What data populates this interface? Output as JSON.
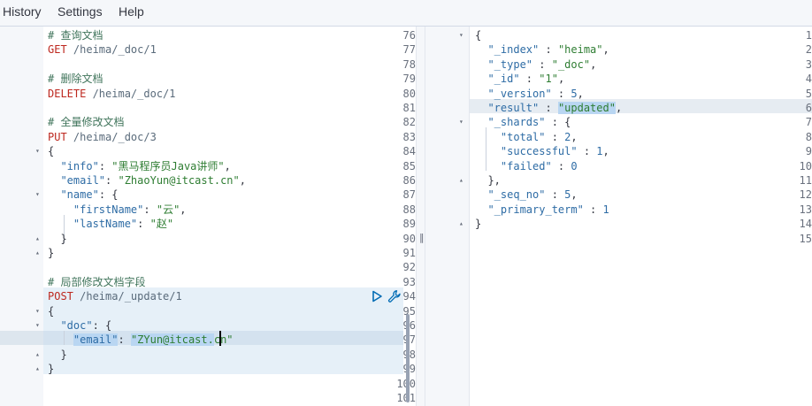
{
  "menu": {
    "history": "History",
    "settings": "Settings",
    "help": "Help"
  },
  "request": {
    "lines": [
      {
        "n": "76",
        "tokens": [
          [
            "comment",
            "# 查询文档"
          ]
        ]
      },
      {
        "n": "77",
        "tokens": [
          [
            "method",
            "GET"
          ],
          [
            "url",
            " /heima/_doc/1"
          ]
        ]
      },
      {
        "n": "78",
        "tokens": []
      },
      {
        "n": "79",
        "tokens": [
          [
            "comment",
            "# 删除文档"
          ]
        ]
      },
      {
        "n": "80",
        "tokens": [
          [
            "method",
            "DELETE"
          ],
          [
            "url",
            " /heima/_doc/1"
          ]
        ]
      },
      {
        "n": "81",
        "tokens": []
      },
      {
        "n": "82",
        "tokens": [
          [
            "comment",
            "# 全量修改文档"
          ]
        ]
      },
      {
        "n": "83",
        "tokens": [
          [
            "method",
            "PUT"
          ],
          [
            "url",
            " /heima/_doc/3"
          ]
        ]
      },
      {
        "n": "84",
        "fold": "▾",
        "tokens": [
          [
            "punc",
            "{"
          ]
        ]
      },
      {
        "n": "85",
        "tokens": [
          [
            "punc",
            "  "
          ],
          [
            "key",
            "\"info\""
          ],
          [
            "punc",
            ": "
          ],
          [
            "str",
            "\"黑马程序员Java讲师\""
          ],
          [
            "punc",
            ","
          ]
        ]
      },
      {
        "n": "86",
        "tokens": [
          [
            "punc",
            "  "
          ],
          [
            "key",
            "\"email\""
          ],
          [
            "punc",
            ": "
          ],
          [
            "str",
            "\"ZhaoYun@itcast.cn\""
          ],
          [
            "punc",
            ","
          ]
        ]
      },
      {
        "n": "87",
        "fold": "▾",
        "tokens": [
          [
            "punc",
            "  "
          ],
          [
            "key",
            "\"name\""
          ],
          [
            "punc",
            ": {"
          ]
        ]
      },
      {
        "n": "88",
        "tokens": [
          [
            "punc",
            "    "
          ],
          [
            "key",
            "\"firstName\""
          ],
          [
            "punc",
            ": "
          ],
          [
            "str",
            "\"云\""
          ],
          [
            "punc",
            ","
          ]
        ]
      },
      {
        "n": "89",
        "tokens": [
          [
            "punc",
            "    "
          ],
          [
            "key",
            "\"lastName\""
          ],
          [
            "punc",
            ": "
          ],
          [
            "str",
            "\"赵\""
          ]
        ]
      },
      {
        "n": "90",
        "fold": "▴",
        "tokens": [
          [
            "punc",
            "  }"
          ]
        ]
      },
      {
        "n": "91",
        "fold": "▴",
        "tokens": [
          [
            "punc",
            "}"
          ]
        ]
      },
      {
        "n": "92",
        "tokens": []
      },
      {
        "n": "93",
        "tokens": [
          [
            "comment",
            "# 局部修改文档字段"
          ]
        ]
      },
      {
        "n": "94",
        "tokens": [
          [
            "method",
            "POST"
          ],
          [
            "url",
            " /heima/_update/1"
          ]
        ]
      },
      {
        "n": "95",
        "fold": "▾",
        "tokens": [
          [
            "punc",
            "{"
          ]
        ]
      },
      {
        "n": "96",
        "fold": "▾",
        "tokens": [
          [
            "punc",
            "  "
          ],
          [
            "key",
            "\"doc\""
          ],
          [
            "punc",
            ": {"
          ]
        ]
      },
      {
        "n": "97",
        "tokens": [
          [
            "punc",
            "    "
          ],
          [
            "key",
            "\"email\"",
            "sel"
          ],
          [
            "punc",
            ": "
          ],
          [
            "str",
            "\"ZYun@itcast.",
            "sel"
          ],
          [
            "str",
            "cn\""
          ]
        ]
      },
      {
        "n": "98",
        "fold": "▴",
        "tokens": [
          [
            "punc",
            "  }"
          ]
        ]
      },
      {
        "n": "99",
        "fold": "▴",
        "tokens": [
          [
            "punc",
            "}"
          ]
        ]
      },
      {
        "n": "100",
        "tokens": []
      },
      {
        "n": "101",
        "tokens": []
      }
    ]
  },
  "response": {
    "lines": [
      {
        "n": "1",
        "fold": "▾",
        "tokens": [
          [
            "punc",
            "{"
          ]
        ]
      },
      {
        "n": "2",
        "tokens": [
          [
            "punc",
            "  "
          ],
          [
            "key",
            "\"_index\""
          ],
          [
            "punc",
            " : "
          ],
          [
            "str",
            "\"heima\""
          ],
          [
            "punc",
            ","
          ]
        ]
      },
      {
        "n": "3",
        "tokens": [
          [
            "punc",
            "  "
          ],
          [
            "key",
            "\"_type\""
          ],
          [
            "punc",
            " : "
          ],
          [
            "str",
            "\"_doc\""
          ],
          [
            "punc",
            ","
          ]
        ]
      },
      {
        "n": "4",
        "tokens": [
          [
            "punc",
            "  "
          ],
          [
            "key",
            "\"_id\""
          ],
          [
            "punc",
            " : "
          ],
          [
            "str",
            "\"1\""
          ],
          [
            "punc",
            ","
          ]
        ]
      },
      {
        "n": "5",
        "tokens": [
          [
            "punc",
            "  "
          ],
          [
            "key",
            "\"_version\""
          ],
          [
            "punc",
            " : "
          ],
          [
            "num",
            "5"
          ],
          [
            "punc",
            ","
          ]
        ]
      },
      {
        "n": "6",
        "tokens": [
          [
            "punc",
            "  "
          ],
          [
            "key",
            "\"result\""
          ],
          [
            "punc",
            " : "
          ],
          [
            "str",
            "\"updated\"",
            "sel"
          ],
          [
            "punc",
            ","
          ]
        ]
      },
      {
        "n": "7",
        "fold": "▾",
        "tokens": [
          [
            "punc",
            "  "
          ],
          [
            "key",
            "\"_shards\""
          ],
          [
            "punc",
            " : {"
          ]
        ]
      },
      {
        "n": "8",
        "tokens": [
          [
            "punc",
            "    "
          ],
          [
            "key",
            "\"total\""
          ],
          [
            "punc",
            " : "
          ],
          [
            "num",
            "2"
          ],
          [
            "punc",
            ","
          ]
        ]
      },
      {
        "n": "9",
        "tokens": [
          [
            "punc",
            "    "
          ],
          [
            "key",
            "\"successful\""
          ],
          [
            "punc",
            " : "
          ],
          [
            "num",
            "1"
          ],
          [
            "punc",
            ","
          ]
        ]
      },
      {
        "n": "10",
        "tokens": [
          [
            "punc",
            "    "
          ],
          [
            "key",
            "\"failed\""
          ],
          [
            "punc",
            " : "
          ],
          [
            "num",
            "0"
          ]
        ]
      },
      {
        "n": "11",
        "fold": "▴",
        "tokens": [
          [
            "punc",
            "  },"
          ]
        ]
      },
      {
        "n": "12",
        "tokens": [
          [
            "punc",
            "  "
          ],
          [
            "key",
            "\"_seq_no\""
          ],
          [
            "punc",
            " : "
          ],
          [
            "num",
            "5"
          ],
          [
            "punc",
            ","
          ]
        ]
      },
      {
        "n": "13",
        "tokens": [
          [
            "punc",
            "  "
          ],
          [
            "key",
            "\"_primary_term\""
          ],
          [
            "punc",
            " : "
          ],
          [
            "num",
            "1"
          ]
        ]
      },
      {
        "n": "14",
        "fold": "▴",
        "tokens": [
          [
            "punc",
            "}"
          ]
        ]
      },
      {
        "n": "15",
        "tokens": []
      }
    ]
  },
  "icons": {
    "run": "play-icon",
    "settings": "wrench-icon",
    "resize": "resize-handle"
  },
  "colors": {
    "method": "#bd271e",
    "key": "#2e6ca5",
    "string": "#2e7d32",
    "comment": "#41755c",
    "selection": "#b9d6f2"
  }
}
